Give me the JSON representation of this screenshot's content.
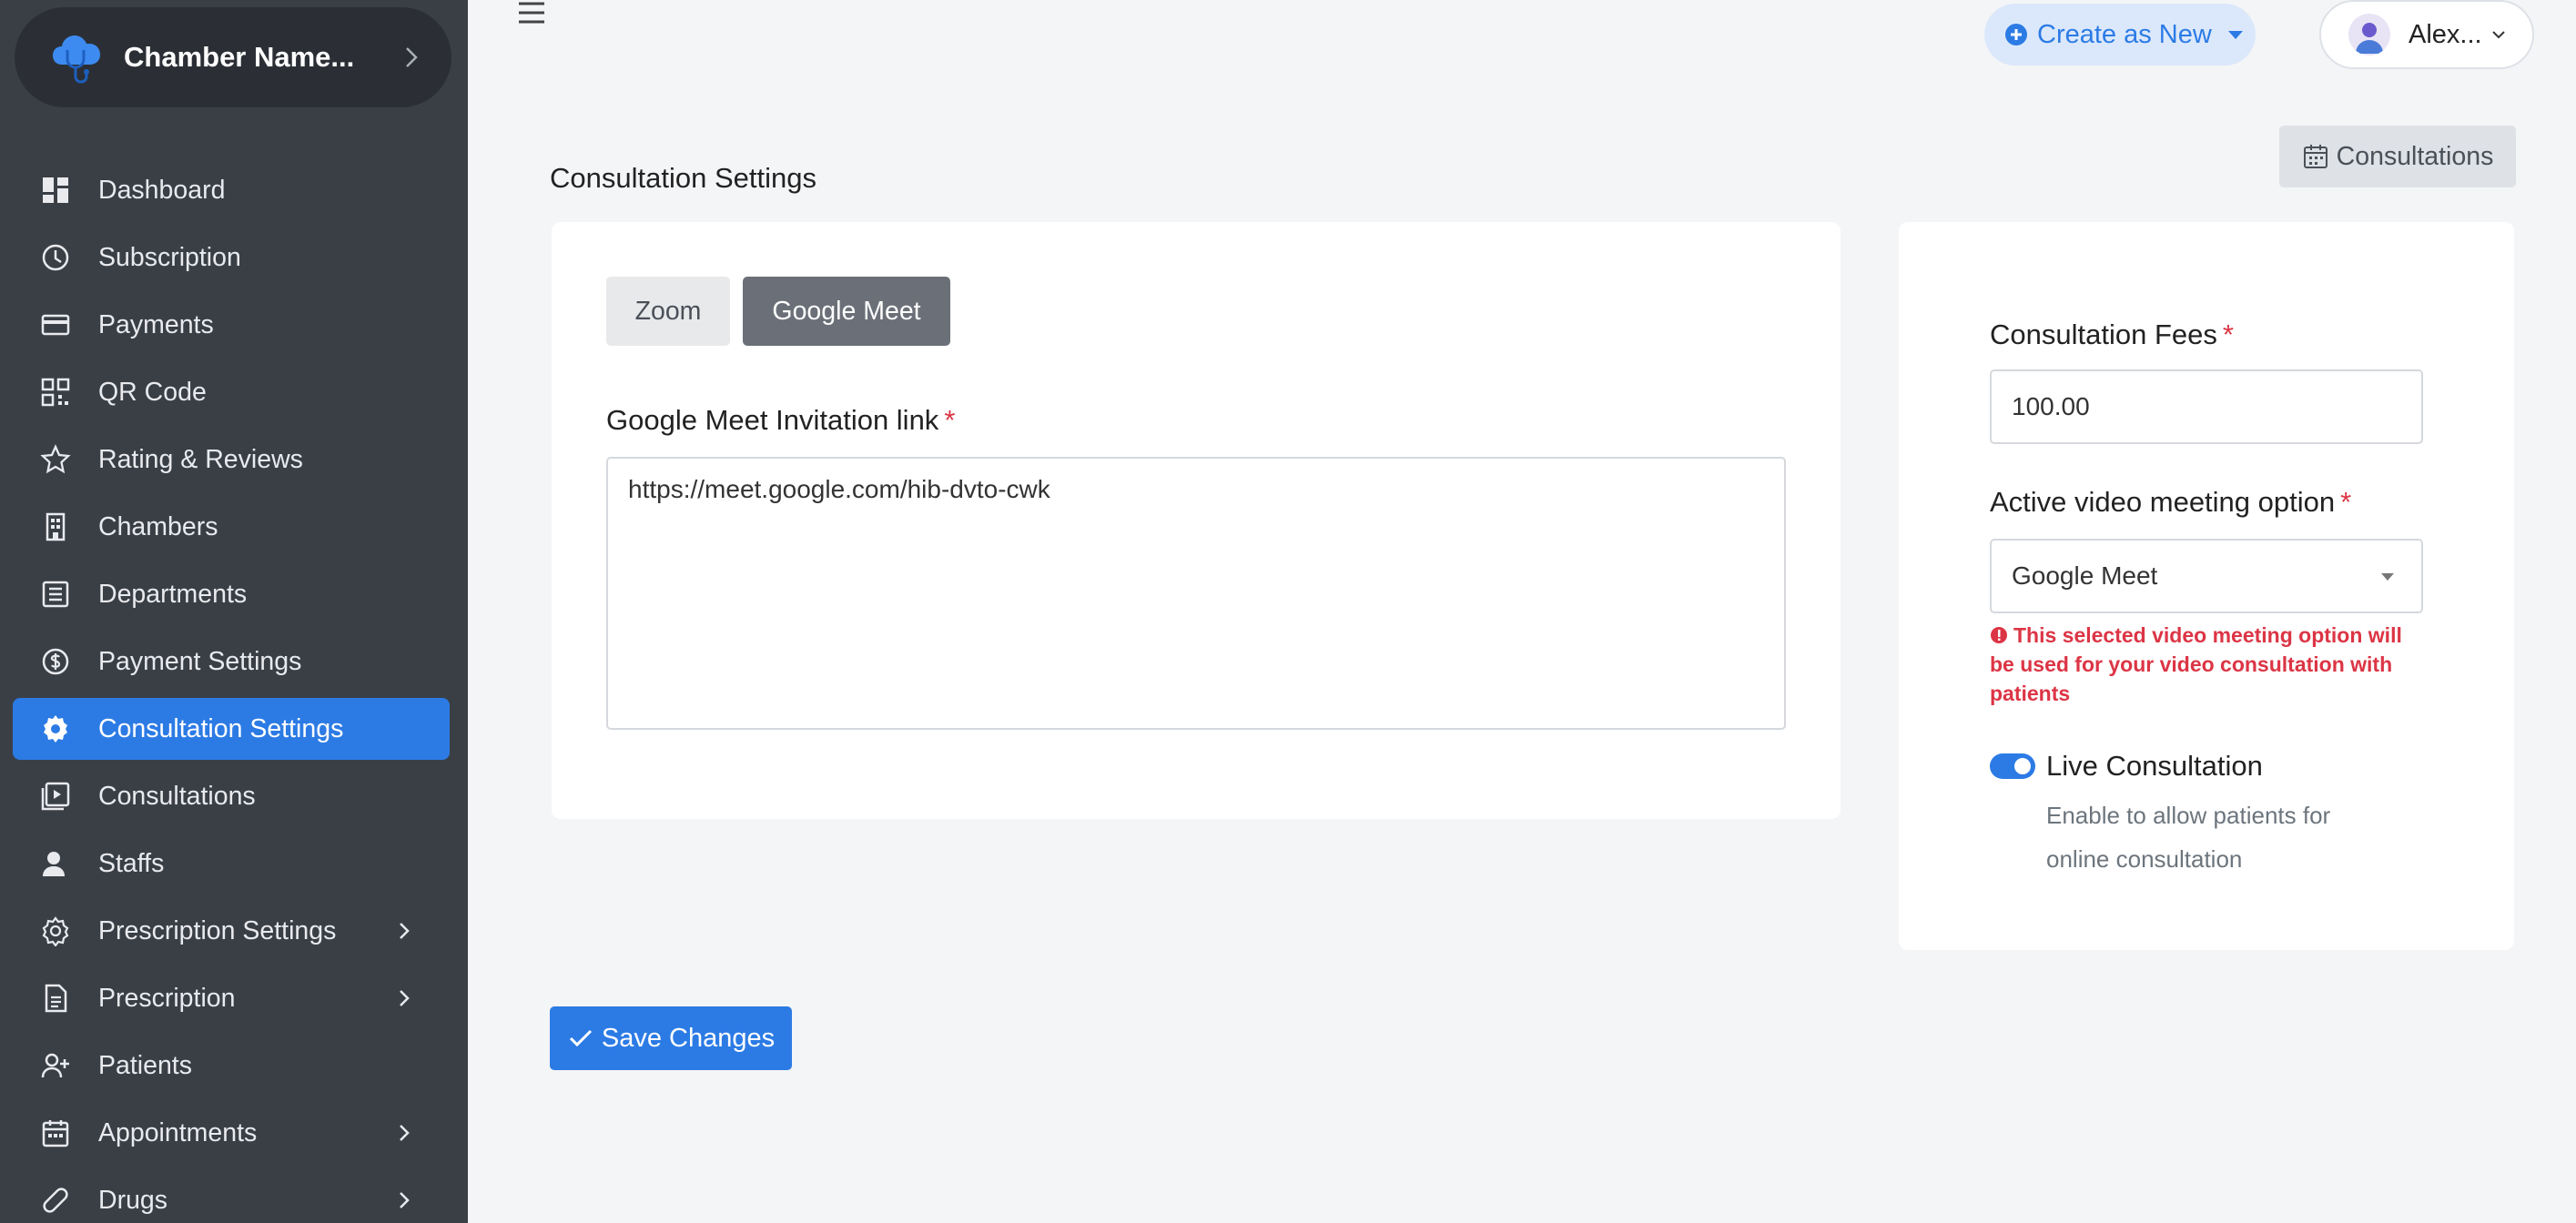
{
  "sidebar": {
    "brand": {
      "name": "Chamber Name...",
      "logo_icon": "cloud-doctor-logo"
    },
    "items": [
      {
        "label": "Dashboard",
        "icon": "dashboard-icon",
        "has_submenu": false,
        "active": false
      },
      {
        "label": "Subscription",
        "icon": "clock-icon",
        "has_submenu": false,
        "active": false
      },
      {
        "label": "Payments",
        "icon": "credit-card-icon",
        "has_submenu": false,
        "active": false
      },
      {
        "label": "QR Code",
        "icon": "qr-code-icon",
        "has_submenu": false,
        "active": false
      },
      {
        "label": "Rating & Reviews",
        "icon": "star-icon",
        "has_submenu": false,
        "active": false
      },
      {
        "label": "Chambers",
        "icon": "building-icon",
        "has_submenu": false,
        "active": false
      },
      {
        "label": "Departments",
        "icon": "list-icon",
        "has_submenu": false,
        "active": false
      },
      {
        "label": "Payment Settings",
        "icon": "dollar-circle-icon",
        "has_submenu": false,
        "active": false
      },
      {
        "label": "Consultation Settings",
        "icon": "gear-icon",
        "has_submenu": false,
        "active": true
      },
      {
        "label": "Consultations",
        "icon": "video-icon",
        "has_submenu": false,
        "active": false
      },
      {
        "label": "Staffs",
        "icon": "user-icon",
        "has_submenu": false,
        "active": false
      },
      {
        "label": "Prescription Settings",
        "icon": "gear-outline-icon",
        "has_submenu": true,
        "active": false
      },
      {
        "label": "Prescription",
        "icon": "document-icon",
        "has_submenu": true,
        "active": false
      },
      {
        "label": "Patients",
        "icon": "user-plus-icon",
        "has_submenu": false,
        "active": false
      },
      {
        "label": "Appointments",
        "icon": "calendar-icon",
        "has_submenu": true,
        "active": false
      },
      {
        "label": "Drugs",
        "icon": "pill-icon",
        "has_submenu": true,
        "active": false
      }
    ]
  },
  "topbar": {
    "menu_icon": "hamburger-icon",
    "create_label": "Create as New",
    "user_name": "Alex..."
  },
  "page": {
    "title": "Consultation Settings",
    "consultations_button": "Consultations"
  },
  "meeting_card": {
    "tabs": [
      {
        "label": "Zoom",
        "active": false
      },
      {
        "label": "Google Meet",
        "active": true
      }
    ],
    "link_label": "Google Meet Invitation link",
    "required_mark": "*",
    "link_value": "https://meet.google.com/hib-dvto-cwk"
  },
  "settings_card": {
    "fees_label": "Consultation Fees",
    "fees_value": "100.00",
    "video_option_label": "Active video meeting option",
    "video_option_value": "Google Meet",
    "warning": "This selected video meeting option will be used for your video consultation with patients",
    "live_label": "Live Consultation",
    "live_enabled": true,
    "live_help": "Enable to allow patients for online consultation"
  },
  "actions": {
    "save_label": "Save Changes"
  },
  "colors": {
    "sidebar_bg": "#3a3f46",
    "accent": "#2c7be5",
    "danger": "#dc3545"
  }
}
